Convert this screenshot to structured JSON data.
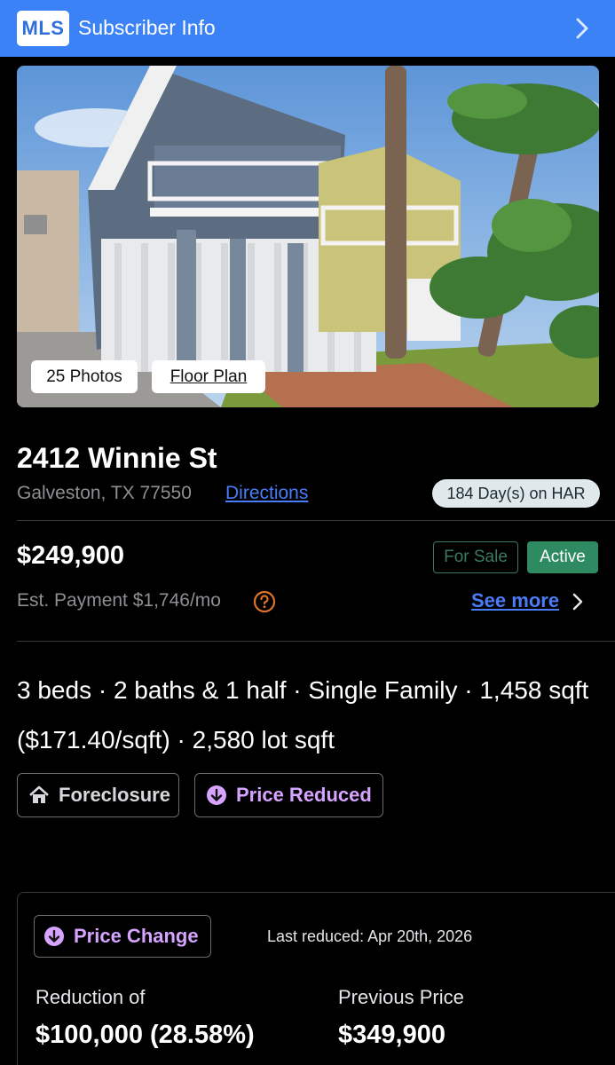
{
  "header": {
    "badge": "MLS",
    "title": "Subscriber Info",
    "icon": "chevron-right-icon"
  },
  "photo": {
    "photos_label": "25 Photos",
    "floor_plan_label": "Floor Plan"
  },
  "listing": {
    "address": "2412 Winnie St",
    "city": "Galveston, TX 77550",
    "directions_label": "Directions",
    "days_on_har": "184 Day(s) on HAR",
    "price": "$249,900",
    "status_for_sale": "For Sale",
    "status_active": "Active",
    "est_payment": "Est. Payment $1,746/mo",
    "see_more_label": "See more",
    "facts": "3 beds · 2 baths & 1 half · Single Family · 1,458 sqft ($171.40/sqft) · 2,580 lot sqft"
  },
  "tags": {
    "foreclosure": "Foreclosure",
    "price_reduced": "Price Reduced"
  },
  "price_change": {
    "button_label": "Price Change",
    "last_reduced": "Last reduced: Apr 20th, 2026",
    "reduction_label": "Reduction of",
    "reduction_value": "$100,000 (28.58%)",
    "previous_label": "Previous Price",
    "previous_value": "$349,900"
  },
  "colors": {
    "header_blue": "#3b82f6",
    "link_blue": "#4b7cf7",
    "active_green": "#2e8b61",
    "purple_accent": "#d6a4ff",
    "help_orange": "#e0742a"
  }
}
